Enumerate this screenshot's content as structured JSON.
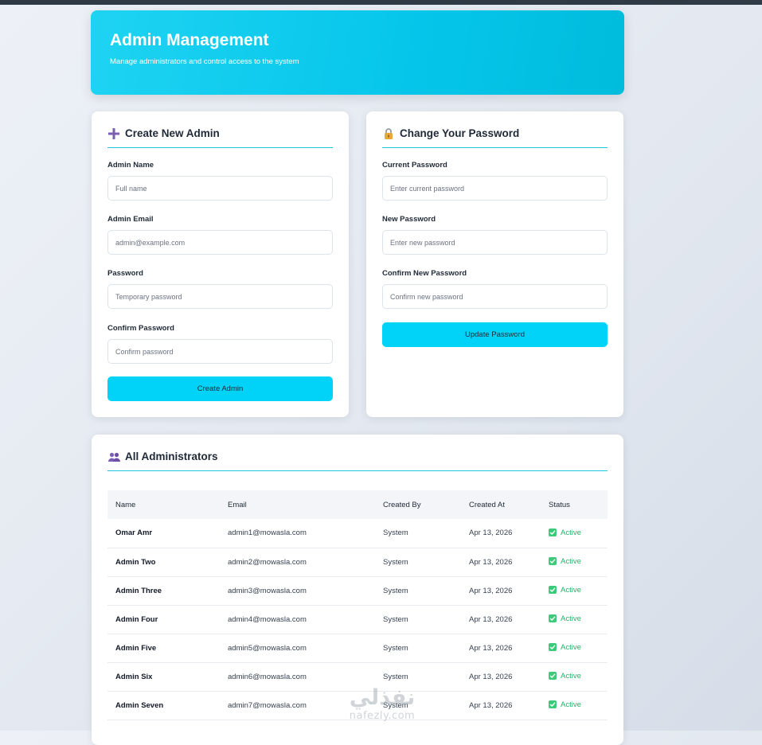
{
  "header": {
    "title": "Admin Management",
    "subtitle": "Manage administrators and control access to the system"
  },
  "create_admin": {
    "title": "Create New Admin",
    "icon": "plus-icon",
    "fields": {
      "name": {
        "label": "Admin Name",
        "placeholder": "Full name"
      },
      "email": {
        "label": "Admin Email",
        "placeholder": "admin@example.com"
      },
      "password": {
        "label": "Password",
        "placeholder": "Temporary password"
      },
      "confirm": {
        "label": "Confirm Password",
        "placeholder": "Confirm password"
      }
    },
    "button": "Create Admin"
  },
  "change_password": {
    "title": "Change Your Password",
    "icon": "lock-icon",
    "fields": {
      "current": {
        "label": "Current Password",
        "placeholder": "Enter current password"
      },
      "new": {
        "label": "New Password",
        "placeholder": "Enter new password"
      },
      "confirm": {
        "label": "Confirm New Password",
        "placeholder": "Confirm new password"
      }
    },
    "button": "Update Password"
  },
  "admins": {
    "title": "All Administrators",
    "icon": "users-icon",
    "columns": [
      "Name",
      "Email",
      "Created By",
      "Created At",
      "Status"
    ],
    "rows": [
      {
        "name": "Omar Amr",
        "email": "admin1@mowasla.com",
        "created_by": "System",
        "created_at": "Apr 13, 2026",
        "status": "Active"
      },
      {
        "name": "Admin Two",
        "email": "admin2@mowasla.com",
        "created_by": "System",
        "created_at": "Apr 13, 2026",
        "status": "Active"
      },
      {
        "name": "Admin Three",
        "email": "admin3@mowasla.com",
        "created_by": "System",
        "created_at": "Apr 13, 2026",
        "status": "Active"
      },
      {
        "name": "Admin Four",
        "email": "admin4@mowasla.com",
        "created_by": "System",
        "created_at": "Apr 13, 2026",
        "status": "Active"
      },
      {
        "name": "Admin Five",
        "email": "admin5@mowasla.com",
        "created_by": "System",
        "created_at": "Apr 13, 2026",
        "status": "Active"
      },
      {
        "name": "Admin Six",
        "email": "admin6@mowasla.com",
        "created_by": "System",
        "created_at": "Apr 13, 2026",
        "status": "Active"
      },
      {
        "name": "Admin Seven",
        "email": "admin7@mowasla.com",
        "created_by": "System",
        "created_at": "Apr 13, 2026",
        "status": "Active"
      }
    ]
  },
  "watermark": {
    "arabic": "نفذلي",
    "latin": "nafezly.com"
  },
  "colors": {
    "accent": "#00d3f7",
    "header": "#05c6ea",
    "active": "#21b46b",
    "title_rule": "#1fc5dc"
  }
}
